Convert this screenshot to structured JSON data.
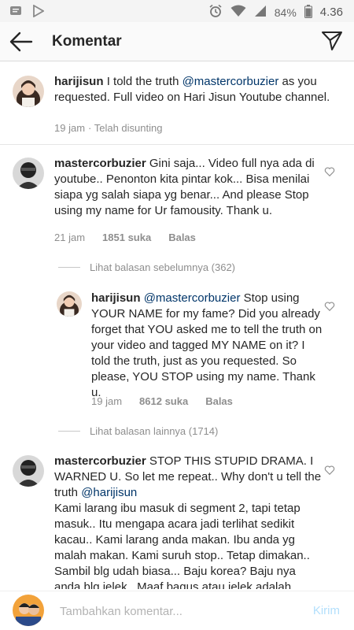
{
  "status_bar": {
    "battery_percent": "84%",
    "time": "4.36",
    "icons": [
      "notification-icon",
      "play-store-icon",
      "alarm-icon",
      "wifi-icon",
      "signal-icon",
      "battery-icon"
    ]
  },
  "header": {
    "title": "Komentar"
  },
  "caption": {
    "username": "harijisun",
    "text_before": "I told the truth ",
    "mention": "@mastercorbuzier",
    "text_after": " as you requested. Full video on Hari Jisun Youtube channel.",
    "time": "19 jam",
    "edited": "· Telah disunting"
  },
  "comments": [
    {
      "username": "mastercorbuzier",
      "text": "Gini saja... Video full nya ada di youtube.. Penonton kita pintar kok... Bisa menilai siapa yg salah siapa yg benar... And please Stop using my name for Ur famousity. Thank u.",
      "time": "21 jam",
      "likes": "1851 suka",
      "reply_label": "Balas",
      "view_previous": "Lihat balasan sebelumnya (362)",
      "reply": {
        "username": "harijisun",
        "mention": "@mastercorbuzier",
        "text": " Stop using YOUR NAME for my fame? Did you already forget that YOU asked me to tell the truth on your video and tagged MY NAME on it? I told the truth, just as you requested. So please, YOU STOP using my name. Thank u.",
        "time": "19 jam",
        "likes": "8612 suka",
        "reply_label": "Balas"
      },
      "view_more": "Lihat balasan lainnya (1714)"
    },
    {
      "username": "mastercorbuzier",
      "text_before": "STOP THIS STUPID DRAMA. I WARNED U. So let me repeat.. Why don't u tell the truth ",
      "mention": "@harijisun",
      "text_after": "Kami larang ibu masuk di segment 2, tapi tetap masuk.. Itu mengapa acara jadi terlihat sedikit kacau.. Kami larang anda makan. Ibu anda yg malah makan. Kami suruh stop.. Tetap dimakan.. Sambil blg udah biasa... Baju korea? Baju nya anda blg jelek.. Maaf bagus atau jelek adalah relatif.. Dan kalau jelek kenapa anda"
    }
  ],
  "composer": {
    "placeholder": "Tambahkan komentar...",
    "post_label": "Kirim"
  }
}
